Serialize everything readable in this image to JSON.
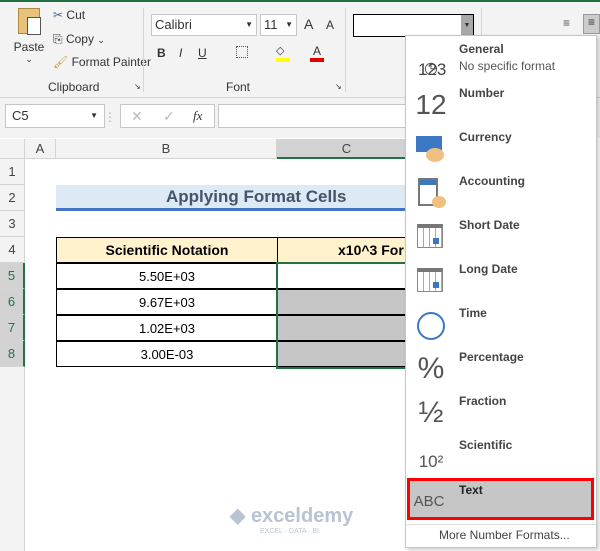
{
  "clipboard": {
    "paste": "Paste",
    "cut": "Cut",
    "copy": "Copy",
    "format_painter": "Format Painter",
    "group_label": "Clipboard"
  },
  "font": {
    "name": "Calibri",
    "size": "11",
    "bold": "B",
    "italic": "I",
    "underline": "U",
    "group_label": "Font",
    "grow": "A",
    "shrink": "A",
    "font_color": "A"
  },
  "number_format": {
    "value": ""
  },
  "formula_bar": {
    "name_box": "C5",
    "fx": "fx",
    "cancel": "✕",
    "enter": "✓",
    "value": ""
  },
  "columns": [
    "A",
    "B",
    "C"
  ],
  "rows": [
    "1",
    "2",
    "3",
    "4",
    "5",
    "6",
    "7",
    "8"
  ],
  "sheet": {
    "title": "Applying Format Cells",
    "headers": [
      "Scientific Notation",
      "x10^3 For"
    ],
    "values": [
      "5.50E+03",
      "9.67E+03",
      "1.02E+03",
      "3.00E-03"
    ]
  },
  "menu": {
    "items": [
      {
        "label": "General",
        "sub": "No specific format",
        "icon": "123"
      },
      {
        "label": "Number",
        "icon": "12"
      },
      {
        "label": "Currency",
        "icon": "💵"
      },
      {
        "label": "Accounting",
        "icon": "▦"
      },
      {
        "label": "Short Date",
        "icon": "▦"
      },
      {
        "label": "Long Date",
        "icon": "▦"
      },
      {
        "label": "Time",
        "icon": "◷"
      },
      {
        "label": "Percentage",
        "icon": "%"
      },
      {
        "label": "Fraction",
        "icon": "½"
      },
      {
        "label": "Scientific",
        "icon": "10²"
      },
      {
        "label": "Text",
        "icon": "ABC"
      }
    ],
    "more": "More Number Formats...",
    "highlight": "#ff0000"
  },
  "watermark": "exceldemy",
  "watermark_sub": "EXCEL · DATA · BI"
}
